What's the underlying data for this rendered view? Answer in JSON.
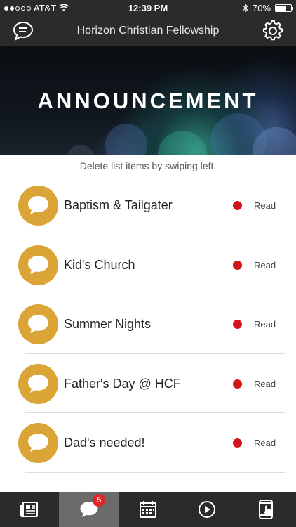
{
  "status_bar": {
    "carrier": "AT&T",
    "time": "12:39 PM",
    "battery": "70%",
    "battery_level": 0.7,
    "signal_bars": 2
  },
  "header": {
    "title": "Horizon Christian Fellowship",
    "left_icon": "chat-bubble-icon",
    "right_icon": "gear-icon"
  },
  "banner": {
    "title": "ANNOUNCEMENT"
  },
  "hint": "Delete list items by swiping left.",
  "announcements": [
    {
      "title": "Baptism & Tailgater",
      "status": "Read"
    },
    {
      "title": "Kid's Church",
      "status": "Read"
    },
    {
      "title": "Summer Nights",
      "status": "Read"
    },
    {
      "title": "Father's Day @ HCF",
      "status": "Read"
    },
    {
      "title": "Dad's needed!",
      "status": "Read"
    }
  ],
  "tab_bar": {
    "tabs": [
      {
        "icon": "newspaper-icon"
      },
      {
        "icon": "chat-bubble-icon",
        "badge": "5",
        "active": true
      },
      {
        "icon": "calendar-icon"
      },
      {
        "icon": "play-icon"
      },
      {
        "icon": "tablet-touch-icon"
      }
    ]
  },
  "colors": {
    "bar_background": "#2b2b2b",
    "avatar": "#dba437",
    "unread_dot": "#d0151d",
    "badge": "#e02424",
    "active_tab": "#6b6b6b"
  }
}
